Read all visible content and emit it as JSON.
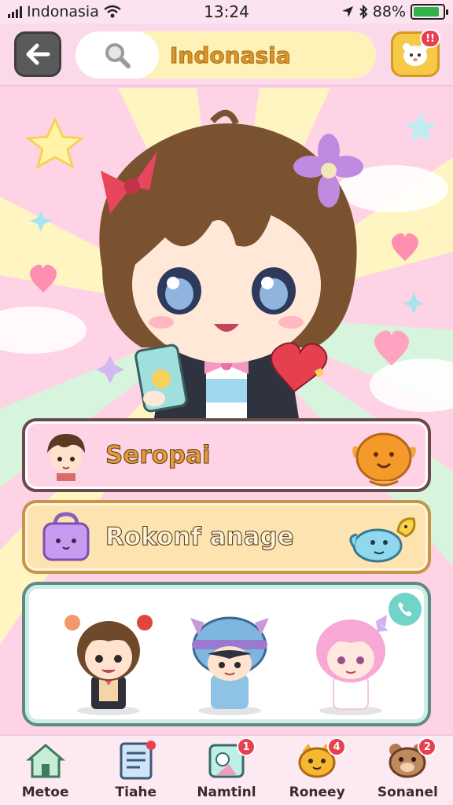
{
  "status_bar": {
    "carrier": "Indonasia",
    "time": "13:24",
    "battery": "88%",
    "icons": [
      "signal-icon",
      "wifi-icon",
      "location-icon",
      "bluetooth-icon",
      "battery-icon"
    ]
  },
  "header": {
    "back_icon": "arrow-left-icon",
    "search_icon": "magnifier-icon",
    "search_text": "Indonasia",
    "mascot_icon": "mascot-icon",
    "mascot_badge": "!!"
  },
  "cards": [
    {
      "label": "Seropai",
      "left_icon": "boy-avatar-icon",
      "right_icon": "orange-creature-icon"
    },
    {
      "label": "Rokonf anage",
      "left_icon": "purple-bag-icon",
      "right_icon": "blue-creature-icon"
    }
  ],
  "gallery": {
    "characters": [
      "brown-hair-girl",
      "blue-hood-kid",
      "pink-hair-girl"
    ],
    "call_icon": "phone-icon"
  },
  "bottom_nav": [
    {
      "label": "Metoe",
      "icon": "house-icon",
      "badge": ""
    },
    {
      "label": "Tiahe",
      "icon": "document-icon",
      "badge": ""
    },
    {
      "label": "Namtinl",
      "icon": "card-icon",
      "badge": "1"
    },
    {
      "label": "Roneey",
      "icon": "cat-icon",
      "badge": "4"
    },
    {
      "label": "Sonanel",
      "icon": "bear-icon",
      "badge": "2"
    }
  ],
  "colors": {
    "header_bg": "#fbd9ea",
    "search_bg": "#fff2b8",
    "search_text": "#d8962c",
    "card1_bg": "#ffd3e6",
    "card2_bg": "#fde3b0",
    "badge": "#e83e4f",
    "gallery_border": "#5f8a82"
  }
}
